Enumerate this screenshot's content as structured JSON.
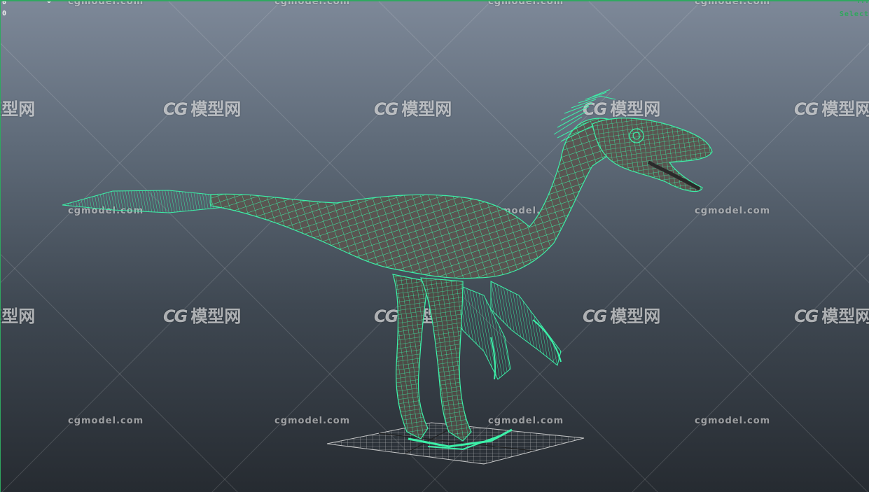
{
  "viewport": {
    "hud": {
      "top_left_value": "0",
      "top_mid_value": "0",
      "top_right_value": "...",
      "select_label": "Select"
    },
    "watermark": {
      "logo_mark": "CG",
      "logo_text": "模型网",
      "url": "cgmodel.com"
    },
    "colors": {
      "wireframe": "#3cf0a8",
      "bg_top": "#7d8898",
      "bg_bottom": "#262b31"
    },
    "subject": "dinosaur-wireframe-icon"
  }
}
